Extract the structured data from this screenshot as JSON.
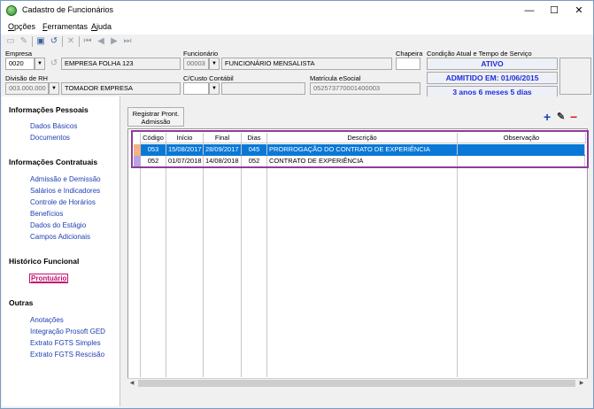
{
  "window": {
    "title": "Cadastro de Funcionários",
    "minimize": "—",
    "maximize": "☐",
    "close": "✕"
  },
  "menu": [
    {
      "underline": "O",
      "rest": "pções"
    },
    {
      "underline": "F",
      "rest": "erramentas"
    },
    {
      "underline": "A",
      "rest": "juda"
    }
  ],
  "header": {
    "empresa_label": "Empresa",
    "empresa_code": "0020",
    "empresa_name": "EMPRESA FOLHA 123",
    "funcionario_label": "Funcionário",
    "funcionario_code": "00003",
    "funcionario_name": "FUNCIONÁRIO MENSALISTA",
    "chapeira_label": "Chapeira",
    "chapeira_value": "",
    "divisao_label": "Divisão de RH",
    "divisao_code": "003.000.000",
    "divisao_name": "TOMADOR EMPRESA",
    "custo_label": "C/Custo Contábil",
    "custo_value": "",
    "matricula_label": "Matrícula eSocial",
    "matricula_value": "052573770001400003"
  },
  "status": {
    "title": "Condição Atual e Tempo de Serviço",
    "state": "ATIVO",
    "admitted": "ADMITIDO EM: 01/06/2015",
    "tenure": "3 anos 6 meses 5 dias"
  },
  "sidebar": {
    "sections": [
      {
        "title": "Informações Pessoais",
        "items": [
          "Dados Básicos",
          "Documentos"
        ]
      },
      {
        "title": "Informações Contratuais",
        "items": [
          "Admissão e Demissão",
          "Salários e Indicadores",
          "Controle de Horários",
          "Benefícios",
          "Dados do Estágio",
          "Campos Adicionais"
        ]
      },
      {
        "title": "Histórico Funcional",
        "items": [
          "Prontuário"
        ]
      },
      {
        "title": "Outras",
        "items": [
          "Anotações",
          "Integração Prosoft GED",
          "Extrato FGTS Simples",
          "Extrato FGTS Rescisão"
        ]
      }
    ]
  },
  "content": {
    "register_button": [
      "Registrar Pront.",
      "Admissão"
    ],
    "add_icon": "+",
    "edit_icon": "✎",
    "remove_icon": "−",
    "table": {
      "columns": [
        "Código",
        "Início",
        "Final",
        "Dias",
        "Descrição",
        "Observação"
      ],
      "rows": [
        {
          "codigo": "053",
          "inicio": "15/08/2017",
          "final": "28/09/2017",
          "dias": "045",
          "descricao": "PRORROGAÇÃO DO CONTRATO DE EXPERIÊNCIA",
          "observacao": ""
        },
        {
          "codigo": "052",
          "inicio": "01/07/2018",
          "final": "14/08/2018",
          "dias": "052",
          "descricao": "CONTRATO DE EXPERIÊNCIA",
          "observacao": ""
        }
      ]
    }
  },
  "colors": {
    "selection": "#0a78d7",
    "highlight_border": "#8e3c9a",
    "link": "#1f3fb4",
    "active_link": "#c0106e",
    "status_text": "#1f2ed6"
  }
}
